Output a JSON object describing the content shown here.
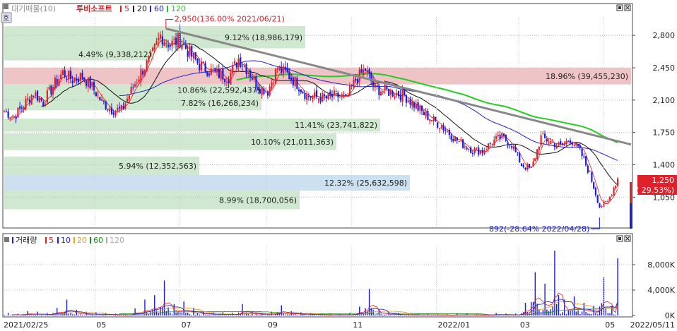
{
  "header": {
    "code_badge": "호",
    "mode_label": "대기매물(10)",
    "stock_name": "투비소프트",
    "ma_periods": [
      "5",
      "20",
      "60",
      "120"
    ]
  },
  "volume_header": {
    "title": "거래량",
    "ma_periods": [
      "5",
      "10",
      "20",
      "60",
      "120"
    ]
  },
  "colors": {
    "up": "#e0202a",
    "down": "#1a1adc",
    "ma5": "#d52020",
    "ma20": "#111111",
    "ma60": "#2020c8",
    "ma120": "#22cc22",
    "trend": "#888888",
    "band_green": "#cfe8cf",
    "band_red": "#efc4c7",
    "band_blue": "#cce0ef"
  },
  "chart_data": [
    {
      "type": "candlestick",
      "x_ticks": [
        "2021/02/25",
        "05",
        "07",
        "09",
        "11",
        "2022/01",
        "03",
        "05",
        "2022/05/11"
      ],
      "y_tick_labels": [
        "2,800",
        "2,450",
        "2,100",
        "1,750",
        "1,400",
        "1,050"
      ],
      "y_ticks": [
        2800,
        2450,
        2100,
        1750,
        1400,
        1050
      ],
      "ylim": [
        740,
        3000
      ],
      "volume_profile": [
        {
          "pct": "9.12%",
          "volume": "18,986,179",
          "label": "9.12% (18,986,179)",
          "low": 2660,
          "high": 2900,
          "color": "green"
        },
        {
          "pct": "4.49%",
          "volume": "9,338,212",
          "label": "4.49% (9,338,212)",
          "low": 2530,
          "high": 2660,
          "color": "green"
        },
        {
          "pct": "18.96%",
          "volume": "39,455,230",
          "label": "18.96% (39,455,230)",
          "low": 2270,
          "high": 2450,
          "color": "red"
        },
        {
          "pct": "10.86%",
          "volume": "22,592,437",
          "label": "10.86% (22,592,437)",
          "low": 2150,
          "high": 2270,
          "color": "green"
        },
        {
          "pct": "7.82%",
          "volume": "16,268,234",
          "label": "7.82% (16,268,234)",
          "low": 1990,
          "high": 2150,
          "color": "green"
        },
        {
          "pct": "11.41%",
          "volume": "23,741,822",
          "label": "11.41% (23,741,822)",
          "low": 1760,
          "high": 1900,
          "color": "green"
        },
        {
          "pct": "10.10%",
          "volume": "21,011,363",
          "label": "10.10% (21,011,363)",
          "low": 1560,
          "high": 1740,
          "color": "green"
        },
        {
          "pct": "5.94%",
          "volume": "12,352,563",
          "label": "5.94% (12,352,563)",
          "low": 1290,
          "high": 1490,
          "color": "green"
        },
        {
          "pct": "12.32%",
          "volume": "25,632,598",
          "label": "12.32% (25,632,598)",
          "low": 1120,
          "high": 1290,
          "color": "blue"
        },
        {
          "pct": "8.99%",
          "volume": "18,700,056",
          "label": "8.99% (18,700,056)",
          "low": 920,
          "high": 1120,
          "color": "green"
        }
      ],
      "high_annotation": {
        "label": "2,950(136.00% 2021/06/21)",
        "value": 2950,
        "date": "2021/06/21"
      },
      "low_annotation": {
        "label": "892(-28.64% 2022/04/28)",
        "value": 892,
        "date": "2022/04/28"
      },
      "last_price": {
        "price": "1,250",
        "change": "( 29.53%)",
        "value": 1250
      },
      "trendline": [
        {
          "date": "2021/06/21",
          "value": 2950
        },
        {
          "date": "2022/05/11",
          "value": 1620
        }
      ],
      "prices_weekly": [
        [
          "2021/02/25",
          1980
        ],
        [
          "2021/03/04",
          1920
        ],
        [
          "2021/03/11",
          2050
        ],
        [
          "2021/03/18",
          2180
        ],
        [
          "2021/03/25",
          2080
        ],
        [
          "2021/04/01",
          2250
        ],
        [
          "2021/04/08",
          2400
        ],
        [
          "2021/04/15",
          2320
        ],
        [
          "2021/04/22",
          2360
        ],
        [
          "2021/04/29",
          2240
        ],
        [
          "2021/05/06",
          2080
        ],
        [
          "2021/05/13",
          2000
        ],
        [
          "2021/05/20",
          1990
        ],
        [
          "2021/05/27",
          2200
        ],
        [
          "2021/06/03",
          2400
        ],
        [
          "2021/06/10",
          2550
        ],
        [
          "2021/06/17",
          2800
        ],
        [
          "2021/06/24",
          2700
        ],
        [
          "2021/07/01",
          2760
        ],
        [
          "2021/07/08",
          2600
        ],
        [
          "2021/07/15",
          2480
        ],
        [
          "2021/07/22",
          2420
        ],
        [
          "2021/07/29",
          2380
        ],
        [
          "2021/08/05",
          2350
        ],
        [
          "2021/08/12",
          2550
        ],
        [
          "2021/08/19",
          2420
        ],
        [
          "2021/08/26",
          2250
        ],
        [
          "2021/09/02",
          2200
        ],
        [
          "2021/09/09",
          2450
        ],
        [
          "2021/09/16",
          2380
        ],
        [
          "2021/09/23",
          2280
        ],
        [
          "2021/09/30",
          2150
        ],
        [
          "2021/10/07",
          2130
        ],
        [
          "2021/10/14",
          2120
        ],
        [
          "2021/10/21",
          2150
        ],
        [
          "2021/10/28",
          2100
        ],
        [
          "2021/11/04",
          2320
        ],
        [
          "2021/11/11",
          2430
        ],
        [
          "2021/11/18",
          2220
        ],
        [
          "2021/11/25",
          2200
        ],
        [
          "2021/12/02",
          2180
        ],
        [
          "2021/12/09",
          2150
        ],
        [
          "2021/12/16",
          2050
        ],
        [
          "2021/12/23",
          1950
        ],
        [
          "2021/12/30",
          1880
        ],
        [
          "2022/01/06",
          1800
        ],
        [
          "2022/01/13",
          1700
        ],
        [
          "2022/01/20",
          1620
        ],
        [
          "2022/01/27",
          1560
        ],
        [
          "2022/02/03",
          1550
        ],
        [
          "2022/02/10",
          1650
        ],
        [
          "2022/02/17",
          1700
        ],
        [
          "2022/02/24",
          1620
        ],
        [
          "2022/03/03",
          1400
        ],
        [
          "2022/03/10",
          1350
        ],
        [
          "2022/03/17",
          1700
        ],
        [
          "2022/03/24",
          1650
        ],
        [
          "2022/03/31",
          1600
        ],
        [
          "2022/04/07",
          1680
        ],
        [
          "2022/04/14",
          1550
        ],
        [
          "2022/04/21",
          1300
        ],
        [
          "2022/04/28",
          950
        ],
        [
          "2022/05/04",
          1000
        ],
        [
          "2022/05/11",
          1250
        ]
      ]
    },
    {
      "type": "bar",
      "title": "거래량",
      "y_tick_labels": [
        "8,000K",
        "4,000K",
        "0K"
      ],
      "y_ticks": [
        8000,
        4000,
        0
      ],
      "ylim": [
        0,
        11000
      ],
      "unit": "K",
      "volume_weekly_k": [
        [
          "2021/02/25",
          400
        ],
        [
          "2021/03/04",
          300
        ],
        [
          "2021/03/11",
          700
        ],
        [
          "2021/03/18",
          600
        ],
        [
          "2021/03/25",
          400
        ],
        [
          "2021/04/01",
          1200
        ],
        [
          "2021/04/08",
          2500
        ],
        [
          "2021/04/15",
          900
        ],
        [
          "2021/04/22",
          600
        ],
        [
          "2021/04/29",
          500
        ],
        [
          "2021/05/06",
          400
        ],
        [
          "2021/05/13",
          300
        ],
        [
          "2021/05/20",
          300
        ],
        [
          "2021/05/27",
          1100
        ],
        [
          "2021/06/03",
          2500
        ],
        [
          "2021/06/10",
          3200
        ],
        [
          "2021/06/17",
          5500
        ],
        [
          "2021/06/24",
          1800
        ],
        [
          "2021/07/01",
          2200
        ],
        [
          "2021/07/08",
          1200
        ],
        [
          "2021/07/15",
          700
        ],
        [
          "2021/07/22",
          500
        ],
        [
          "2021/07/29",
          500
        ],
        [
          "2021/08/05",
          400
        ],
        [
          "2021/08/12",
          1800
        ],
        [
          "2021/08/19",
          700
        ],
        [
          "2021/08/26",
          400
        ],
        [
          "2021/09/02",
          600
        ],
        [
          "2021/09/09",
          1600
        ],
        [
          "2021/09/16",
          700
        ],
        [
          "2021/09/23",
          500
        ],
        [
          "2021/09/30",
          400
        ],
        [
          "2021/10/07",
          300
        ],
        [
          "2021/10/14",
          300
        ],
        [
          "2021/10/21",
          300
        ],
        [
          "2021/10/28",
          400
        ],
        [
          "2021/11/04",
          1400
        ],
        [
          "2021/11/11",
          4200
        ],
        [
          "2021/11/18",
          1000
        ],
        [
          "2021/11/25",
          500
        ],
        [
          "2021/12/02",
          400
        ],
        [
          "2021/12/09",
          300
        ],
        [
          "2021/12/16",
          300
        ],
        [
          "2021/12/23",
          300
        ],
        [
          "2021/12/30",
          200
        ],
        [
          "2022/01/06",
          200
        ],
        [
          "2022/01/13",
          300
        ],
        [
          "2022/01/20",
          300
        ],
        [
          "2022/01/27",
          200
        ],
        [
          "2022/02/03",
          200
        ],
        [
          "2022/02/10",
          400
        ],
        [
          "2022/02/17",
          300
        ],
        [
          "2022/02/24",
          300
        ],
        [
          "2022/03/03",
          2000
        ],
        [
          "2022/03/10",
          6800
        ],
        [
          "2022/03/17",
          5000
        ],
        [
          "2022/03/24",
          10200
        ],
        [
          "2022/03/31",
          2500
        ],
        [
          "2022/04/07",
          3000
        ],
        [
          "2022/04/14",
          2000
        ],
        [
          "2022/04/21",
          1500
        ],
        [
          "2022/04/28",
          6000
        ],
        [
          "2022/05/04",
          1500
        ],
        [
          "2022/05/11",
          9000
        ]
      ]
    }
  ]
}
